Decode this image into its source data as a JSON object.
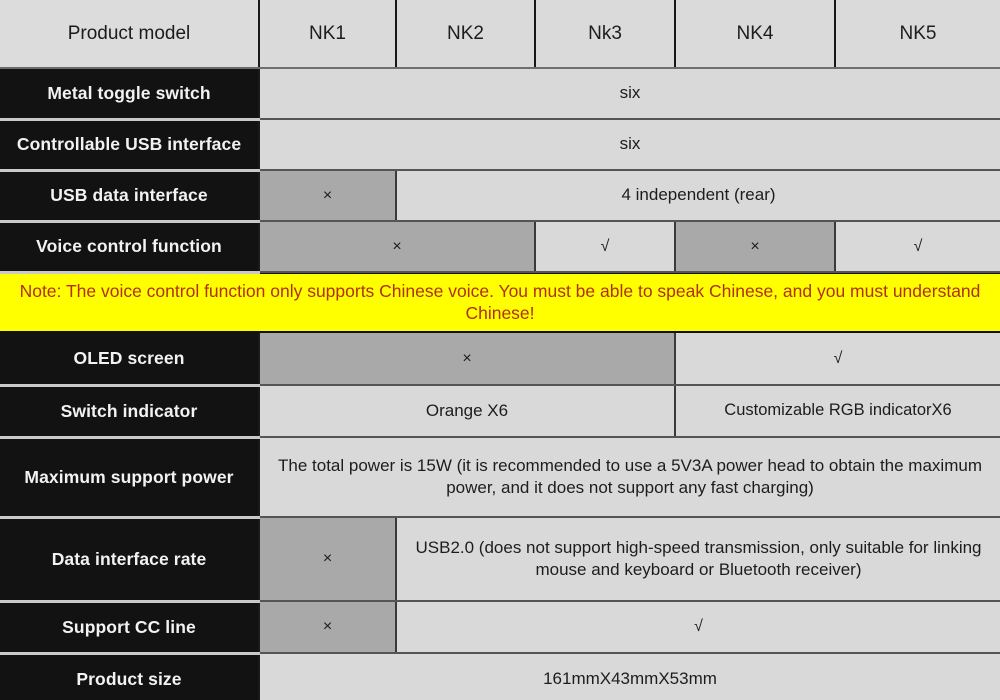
{
  "table": {
    "columns": [
      {
        "key": "label",
        "label": "Product model"
      },
      {
        "key": "nk1",
        "label": "NK1"
      },
      {
        "key": "nk2",
        "label": "NK2"
      },
      {
        "key": "nk3",
        "label": "Nk3"
      },
      {
        "key": "nk4",
        "label": "NK4"
      },
      {
        "key": "nk5",
        "label": "NK5"
      }
    ],
    "rows": {
      "metal_toggle_switch": {
        "label": "Metal toggle switch",
        "value_all": "six"
      },
      "controllable_usb_interface": {
        "label": "Controllable USB interface",
        "value_all": "six"
      },
      "usb_data_interface": {
        "label": "USB data interface",
        "nk1": "×",
        "rest": "4 independent (rear)"
      },
      "voice_control_function": {
        "label": "Voice control function",
        "nk1_nk2": "×",
        "nk3": "√",
        "nk4": "×",
        "nk5": "√"
      },
      "note": {
        "text": "Note: The voice control function only supports Chinese voice. You must be able to speak Chinese, and you must understand Chinese!"
      },
      "oled_screen": {
        "label": "OLED screen",
        "nk1_nk3": "×",
        "nk4_nk5": "√"
      },
      "switch_indicator": {
        "label": "Switch indicator",
        "nk1_nk3": "Orange X6",
        "nk4_nk5": "Customizable RGB indicatorX6"
      },
      "maximum_support_power": {
        "label": "Maximum support power",
        "value_all": "The total power is 15W (it is recommended to use a 5V3A power head to obtain the maximum power, and it does not support any fast charging)"
      },
      "data_interface_rate": {
        "label": "Data interface rate",
        "nk1": "×",
        "rest": "USB2.0 (does not support high-speed transmission, only suitable for linking mouse and keyboard or Bluetooth receiver)"
      },
      "support_cc_line": {
        "label": "Support CC line",
        "nk1": "×",
        "rest": "√"
      },
      "product_size": {
        "label": "Product size",
        "value_all": "161mmX43mmX53mm"
      }
    }
  },
  "colors": {
    "note_background": "#ffff00",
    "note_text": "#b03010",
    "label_background": "#121212",
    "label_text": "#f2f2f2",
    "cell_background": "#d9d9d9",
    "unsupported_background": "#a9a9a9"
  }
}
